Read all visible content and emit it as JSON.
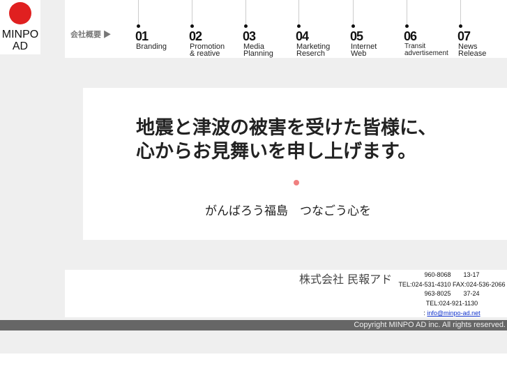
{
  "logo": {
    "mark": "民 報 AD",
    "text_line1": "MINPO",
    "text_line2": "AD"
  },
  "header": {
    "about_label": "会社概要 ▶",
    "nav": [
      {
        "num": "01",
        "line1": "Branding",
        "line2": ""
      },
      {
        "num": "02",
        "line1": "Promotion",
        "line2": "& reative"
      },
      {
        "num": "03",
        "line1": "Media",
        "line2": "Planning"
      },
      {
        "num": "04",
        "line1": "Marketing",
        "line2": "Reserch"
      },
      {
        "num": "05",
        "line1": "Internet",
        "line2": "Web"
      },
      {
        "num": "06",
        "line1": "Transit",
        "line2": "advertisement"
      },
      {
        "num": "07",
        "line1": "News",
        "line2": "Release"
      }
    ]
  },
  "main": {
    "message_line1": "地震と津波の被害を受けた皆様に、",
    "message_line2": "心からお見舞いを申し上げます。",
    "subtitle": "がんばろう福島　つなごう心を"
  },
  "footer": {
    "company": "株式会社 民報アド",
    "lines": [
      "960-8068　　13-17",
      "TEL:024-531-4310 FAX:024-536-2066",
      "963-8025　　37-24",
      "TEL:024-921-1130"
    ],
    "email_prefix": ": ",
    "email": "info@minpo-ad.net",
    "copyright": "Copyright MINPO AD inc. All rights reserved."
  }
}
